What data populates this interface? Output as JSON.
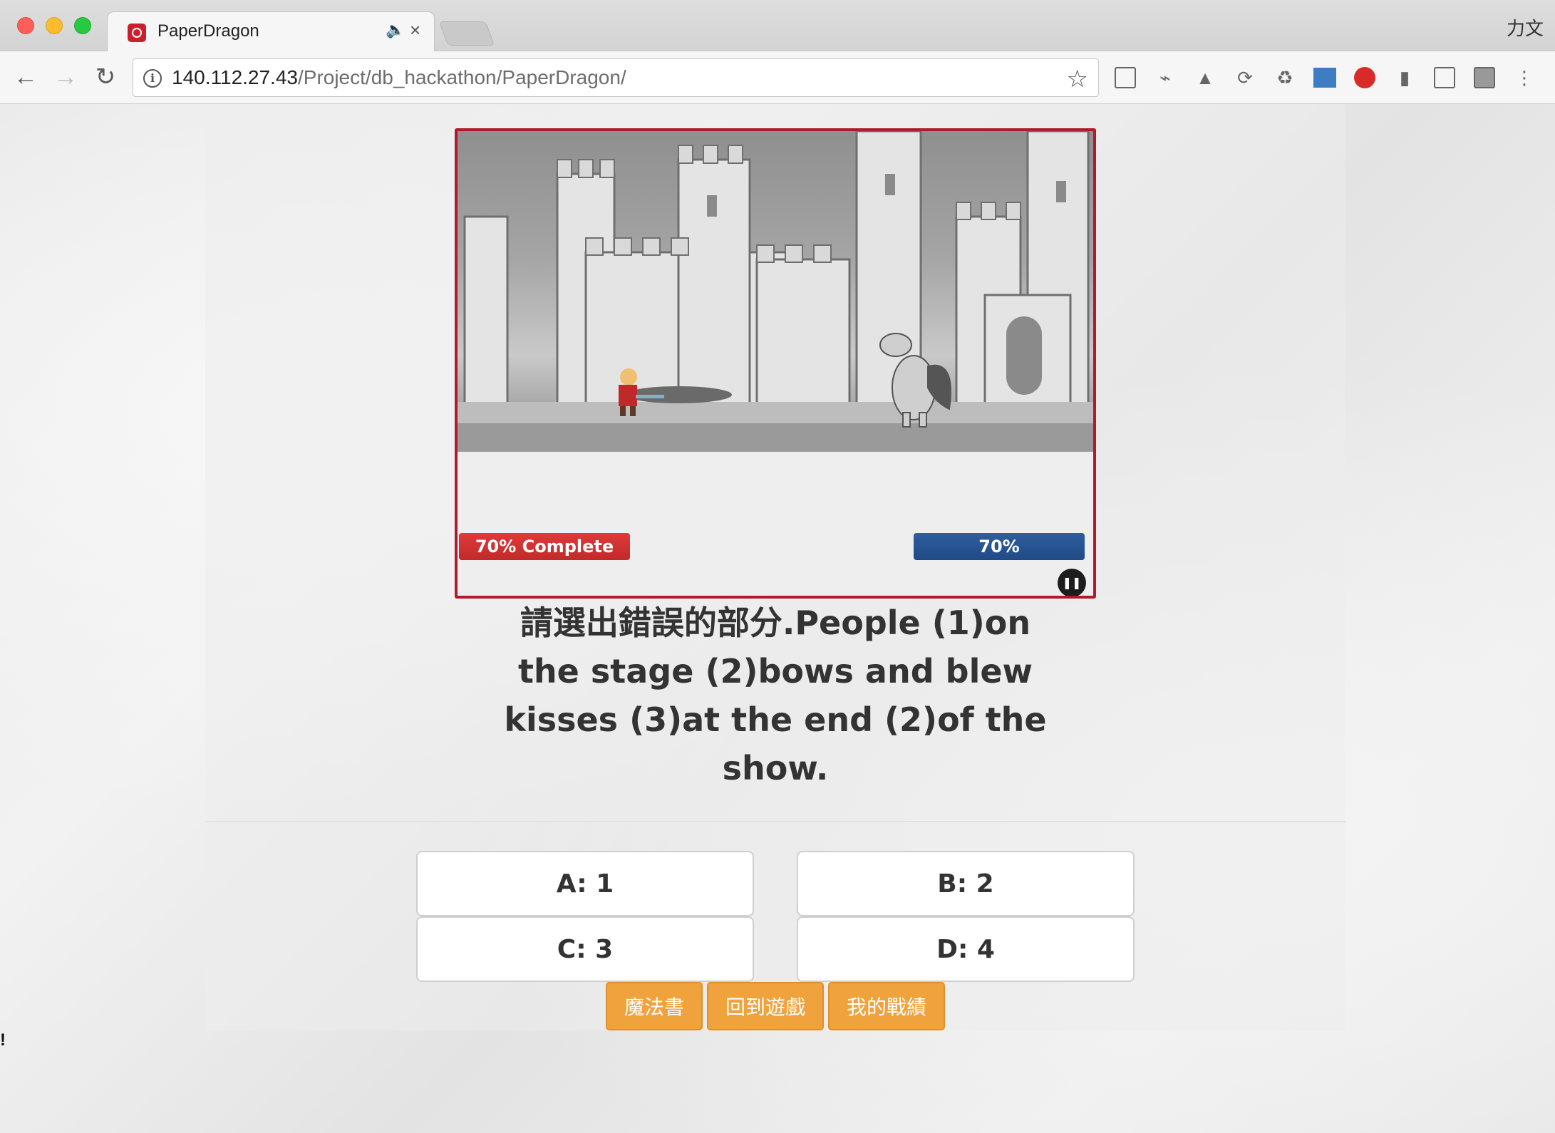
{
  "browser": {
    "tab_title": "PaperDragon",
    "tab_audio_icon": "speaker-icon",
    "tab_close": "×",
    "profile_label": "力文",
    "url_host": "140.112.27.43",
    "url_path": "/Project/db_hackathon/PaperDragon/",
    "nav": {
      "back": "←",
      "forward": "→",
      "reload": "↻"
    },
    "extension_icons": [
      "reader-icon",
      "cast-icon",
      "drive-icon",
      "sync-icon",
      "recycle-icon",
      "metro-icon",
      "block-icon",
      "pin-icon",
      "screenshot-icon",
      "counter-icon",
      "menu-icon"
    ]
  },
  "game": {
    "progress_label": "70% Complete",
    "progress_percent": 70,
    "health_label": "70%",
    "health_percent": 70,
    "pause_symbol": "❚❚"
  },
  "question": {
    "text": "請選出錯誤的部分.People (1)on the stage (2)bows and blew kisses (3)at the end (2)of the show."
  },
  "answers": [
    {
      "label": "A: 1"
    },
    {
      "label": "B: 2"
    },
    {
      "label": "C: 3"
    },
    {
      "label": "D: 4"
    }
  ],
  "menu": {
    "spellbook": "魔法書",
    "back_to_game": "回到遊戲",
    "my_record": "我的戰績"
  },
  "stray_text": "!",
  "colors": {
    "frame_border": "#b01a2b",
    "progress_red": "#d03030",
    "progress_blue": "#2a5692",
    "menu_orange": "#f0a23c"
  }
}
